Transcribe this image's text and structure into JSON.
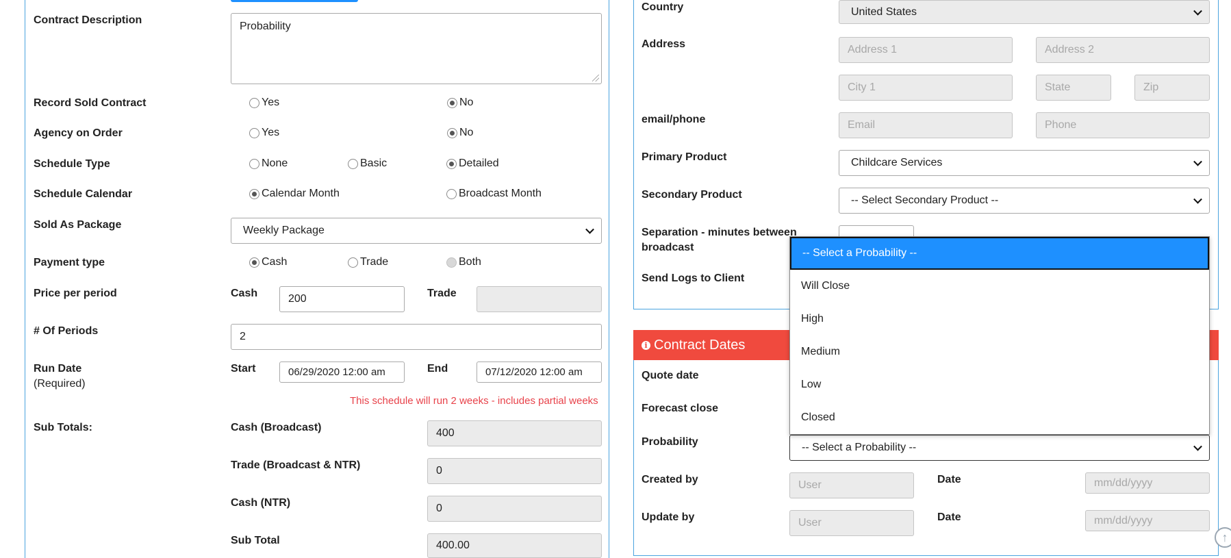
{
  "left": {
    "contract_description": {
      "label": "Contract Description",
      "value": "Probability"
    },
    "record_sold_contract": {
      "label": "Record Sold Contract",
      "yes": "Yes",
      "no": "No"
    },
    "agency_on_order": {
      "label": "Agency on Order",
      "yes": "Yes",
      "no": "No"
    },
    "schedule_type": {
      "label": "Schedule Type",
      "none": "None",
      "basic": "Basic",
      "detailed": "Detailed"
    },
    "schedule_calendar": {
      "label": "Schedule Calendar",
      "calendar_month": "Calendar Month",
      "broadcast_month": "Broadcast Month"
    },
    "sold_as_package": {
      "label": "Sold As Package",
      "value": "Weekly Package"
    },
    "payment_type": {
      "label": "Payment type",
      "cash": "Cash",
      "trade": "Trade",
      "both": "Both"
    },
    "price_per_period": {
      "label": "Price per period",
      "cash_label": "Cash",
      "cash_value": "200",
      "trade_label": "Trade",
      "trade_value": ""
    },
    "num_periods": {
      "label": "# Of Periods",
      "value": "2"
    },
    "run_date": {
      "label": "Run Date",
      "sublabel": "(Required)",
      "start_label": "Start",
      "start_value": "06/29/2020 12:00 am",
      "end_label": "End",
      "end_value": "07/12/2020 12:00 am"
    },
    "schedule_notice": "This schedule will run 2 weeks - includes partial weeks",
    "sub_totals": {
      "label": "Sub Totals:",
      "cash_broadcast_label": "Cash (Broadcast)",
      "cash_broadcast_value": "400",
      "trade_label": "Trade (Broadcast & NTR)",
      "trade_value": "0",
      "cash_ntr_label": "Cash (NTR)",
      "cash_ntr_value": "0",
      "sub_total_label": "Sub Total",
      "sub_total_value": "400.00"
    }
  },
  "right": {
    "country": {
      "label": "Country",
      "value": "United States"
    },
    "address": {
      "label": "Address",
      "address1_ph": "Address 1",
      "address2_ph": "Address 2",
      "city_ph": "City 1",
      "state_ph": "State",
      "zip_ph": "Zip"
    },
    "email_phone": {
      "label": "email/phone",
      "email_ph": "Email",
      "phone_ph": "Phone"
    },
    "primary_product": {
      "label": "Primary Product",
      "value": "Childcare Services"
    },
    "secondary_product": {
      "label": "Secondary Product",
      "value": "-- Select Secondary Product --"
    },
    "separation": {
      "label_line1": "Separation - minutes between",
      "label_line2": "broadcast"
    },
    "send_logs": {
      "label": "Send Logs to Client"
    },
    "contract_dates": {
      "header": "Contract Dates",
      "quote_date_label": "Quote date",
      "forecast_close_label": "Forecast close",
      "probability_label": "Probability",
      "probability_value": "-- Select a Probability --",
      "created_by_label": "Created by",
      "created_by_ph": "User",
      "created_date_label": "Date",
      "created_date_ph": "mm/dd/yyyy",
      "update_by_label": "Update by",
      "update_by_ph": "User",
      "update_date_label": "Date",
      "update_date_ph": "mm/dd/yyyy"
    },
    "probability_dropdown": {
      "options": [
        "-- Select a Probability --",
        "Will Close",
        "High",
        "Medium",
        "Low",
        "Closed"
      ],
      "selected_index": 0
    }
  },
  "colors": {
    "accent_blue": "#1e90ff",
    "header_red": "#f04a3e",
    "notice_red": "#e8424a",
    "panel_border": "#4aa3df"
  }
}
